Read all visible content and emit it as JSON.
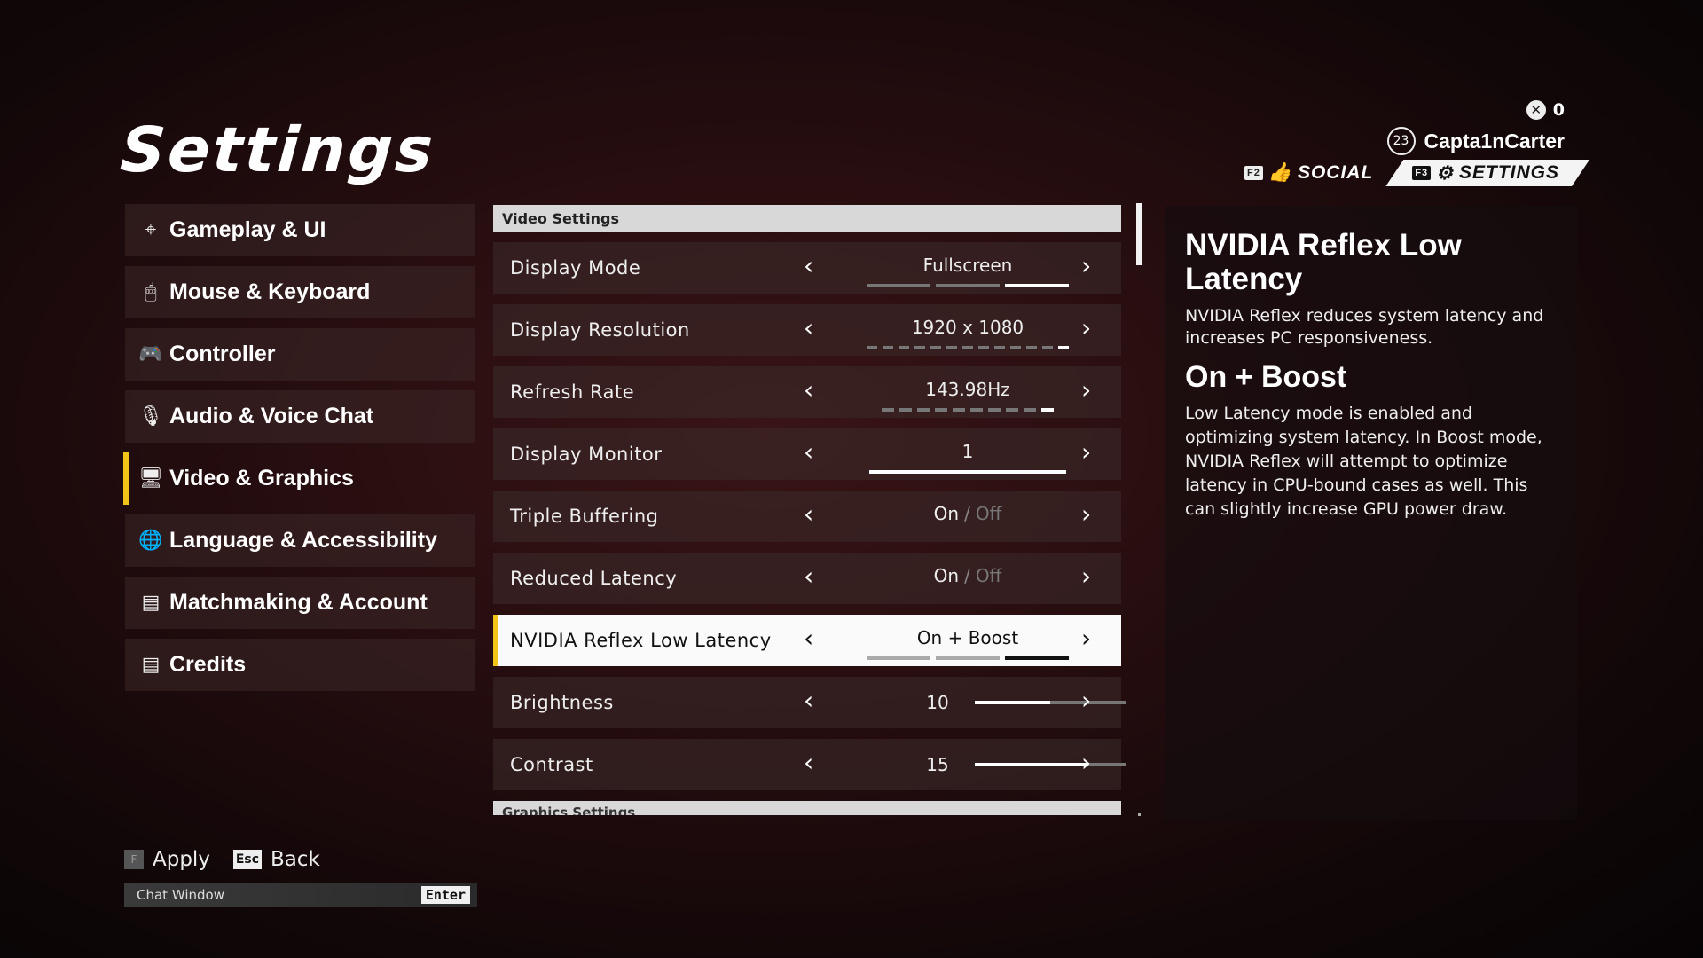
{
  "page": {
    "title": "Settings"
  },
  "user": {
    "level": "23",
    "name": "Capta1nCarter",
    "notification_count": "0"
  },
  "nav": {
    "social": {
      "key": "F2",
      "label": "SOCIAL"
    },
    "settings": {
      "key": "F3",
      "label": "SETTINGS"
    }
  },
  "sidebar": {
    "items": [
      {
        "label": "Gameplay & UI",
        "icon": "crosshair-icon"
      },
      {
        "label": "Mouse & Keyboard",
        "icon": "mouse-icon"
      },
      {
        "label": "Controller",
        "icon": "gamepad-icon"
      },
      {
        "label": "Audio & Voice Chat",
        "icon": "microphone-icon"
      },
      {
        "label": "Video & Graphics",
        "icon": "monitor-icon"
      },
      {
        "label": "Language & Accessibility",
        "icon": "globe-icon"
      },
      {
        "label": "Matchmaking & Account",
        "icon": "document-icon"
      },
      {
        "label": "Credits",
        "icon": "document-icon"
      }
    ],
    "active_index": 4
  },
  "video": {
    "header": "Video Settings",
    "rows": [
      {
        "label": "Display Mode",
        "value": "Fullscreen",
        "option_count": 3,
        "selected": 2
      },
      {
        "label": "Display Resolution",
        "value": "1920 x 1080",
        "option_count": 13,
        "selected": 12
      },
      {
        "label": "Refresh Rate",
        "value": "143.98Hz",
        "option_count": 10,
        "selected": 9
      },
      {
        "label": "Display Monitor",
        "value": "1",
        "option_count": 1,
        "selected": 0
      },
      {
        "label": "Triple Buffering",
        "on": "On",
        "sep": "/",
        "off": "Off"
      },
      {
        "label": "Reduced Latency",
        "on": "On",
        "sep": "/",
        "off": "Off"
      },
      {
        "label": "NVIDIA Reflex Low Latency",
        "value": "On + Boost",
        "option_count": 3,
        "selected": 2
      },
      {
        "label": "Brightness",
        "value": "10",
        "fraction": 0.5
      },
      {
        "label": "Contrast",
        "value": "15",
        "fraction": 0.75
      }
    ],
    "selected_row": 6,
    "next_header": "Graphics Settings"
  },
  "description": {
    "title": "NVIDIA Reflex Low Latency",
    "text": "NVIDIA Reflex reduces system latency and increases PC responsiveness.",
    "option_name": "On + Boost",
    "option_text": "Low Latency mode is enabled and optimizing system latency. In Boost mode, NVIDIA Reflex will attempt to optimize latency in CPU-bound cases as well. This can slightly increase GPU power draw."
  },
  "footer": {
    "apply": {
      "key": "F",
      "label": "Apply"
    },
    "back": {
      "key": "Esc",
      "label": "Back"
    },
    "chat": {
      "label": "Chat Window",
      "key": "Enter"
    }
  },
  "colors": {
    "accent": "#f2c318",
    "highlight_row": "#fafafa"
  }
}
